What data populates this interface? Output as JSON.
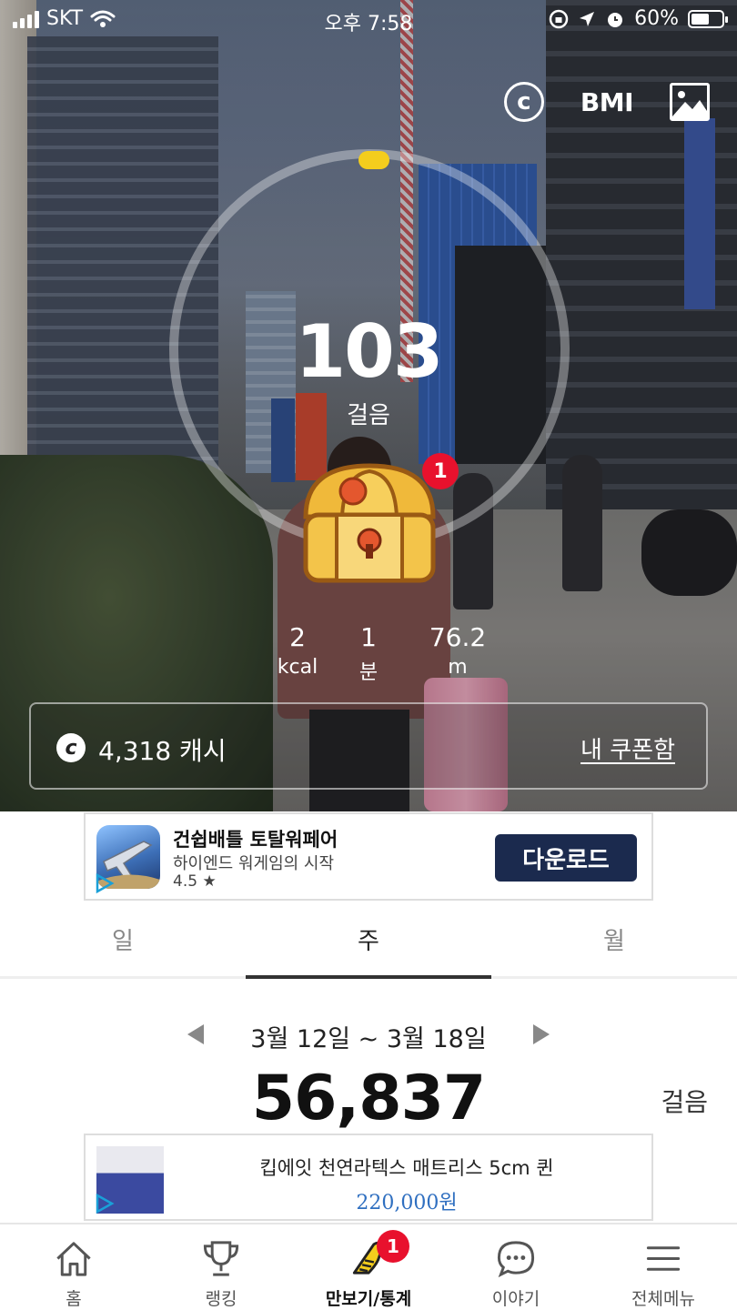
{
  "status_bar": {
    "carrier": "SKT",
    "time": "오후 7:58",
    "battery": "60%",
    "battery_level": 0.6
  },
  "top_actions": {
    "coin_icon": "c",
    "bmi_label": "BMI",
    "gallery_icon": "image-icon"
  },
  "pedometer": {
    "steps": "103",
    "steps_label": "걸음",
    "chest_badge": "1",
    "stats": [
      {
        "value": "2",
        "unit": "kcal"
      },
      {
        "value": "1",
        "unit": "분"
      },
      {
        "value": "76.2",
        "unit": "m"
      }
    ]
  },
  "cash": {
    "icon": "c",
    "amount": "4,318 캐시",
    "coupon_link": "내 쿠폰함"
  },
  "ad_top": {
    "title": "건쉽배틀 토탈워페어",
    "subtitle": "하이엔드 워게임의 시작",
    "rating": "4.5 ★",
    "button": "다운로드"
  },
  "tabs": [
    {
      "label": "일",
      "active": false
    },
    {
      "label": "주",
      "active": true
    },
    {
      "label": "월",
      "active": false
    }
  ],
  "week": {
    "range": "3월 12일 ~ 3월 18일",
    "total": "56,837",
    "unit": "걸음"
  },
  "ad_bottom": {
    "title": "킵에잇 천연라텍스 매트리스 5cm 퀸",
    "price": "220,000원"
  },
  "bottom_nav": [
    {
      "label": "홈",
      "icon": "home-icon"
    },
    {
      "label": "랭킹",
      "icon": "trophy-icon"
    },
    {
      "label": "만보기/통계",
      "icon": "shoe-icon",
      "badge": "1",
      "active": true
    },
    {
      "label": "이야기",
      "icon": "chat-icon"
    },
    {
      "label": "전체메뉴",
      "icon": "menu-icon"
    }
  ],
  "colors": {
    "ring_marker": "#f4cd1d",
    "badge": "#e8112d",
    "download_button": "#1b2a4e",
    "price": "#2f6fc0"
  }
}
